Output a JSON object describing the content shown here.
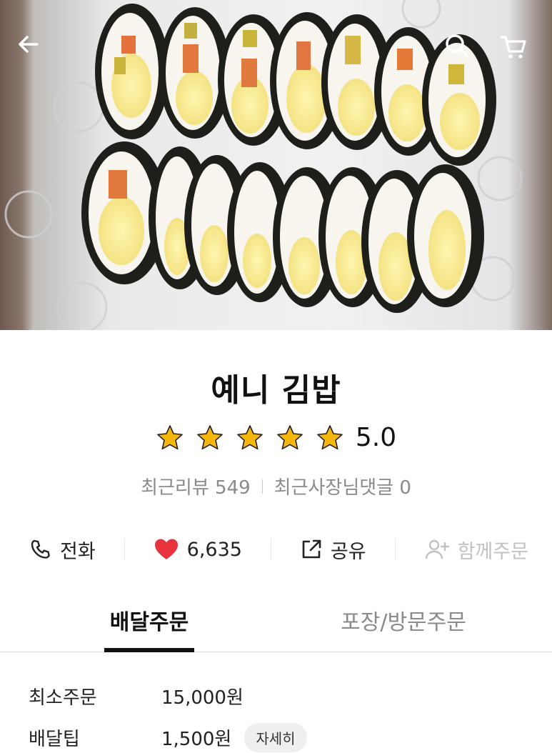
{
  "header": {
    "back_icon": "back-arrow-icon",
    "search_icon": "search-icon",
    "cart_icon": "cart-icon"
  },
  "hero": {
    "alt": "kimbap-photo"
  },
  "store": {
    "name": "예니 김밥",
    "rating": "5.0",
    "stars": 5,
    "recent_reviews_label": "최근리뷰 549",
    "recent_owner_replies_label": "최근사장님댓글 0"
  },
  "actions": {
    "call_label": "전화",
    "likes_count": "6,635",
    "share_label": "공유",
    "group_order_label": "함께주문"
  },
  "tabs": {
    "delivery": "배달주문",
    "pickup": "포장/방문주문"
  },
  "info": {
    "min_order_label": "최소주문",
    "min_order_value": "15,000원",
    "delivery_tip_label": "배달팁",
    "delivery_tip_value": "1,500원",
    "details_button": "자세히"
  },
  "colors": {
    "heart": "#e8333f",
    "star": "#f5b70d",
    "muted": "#8a8a8a"
  }
}
